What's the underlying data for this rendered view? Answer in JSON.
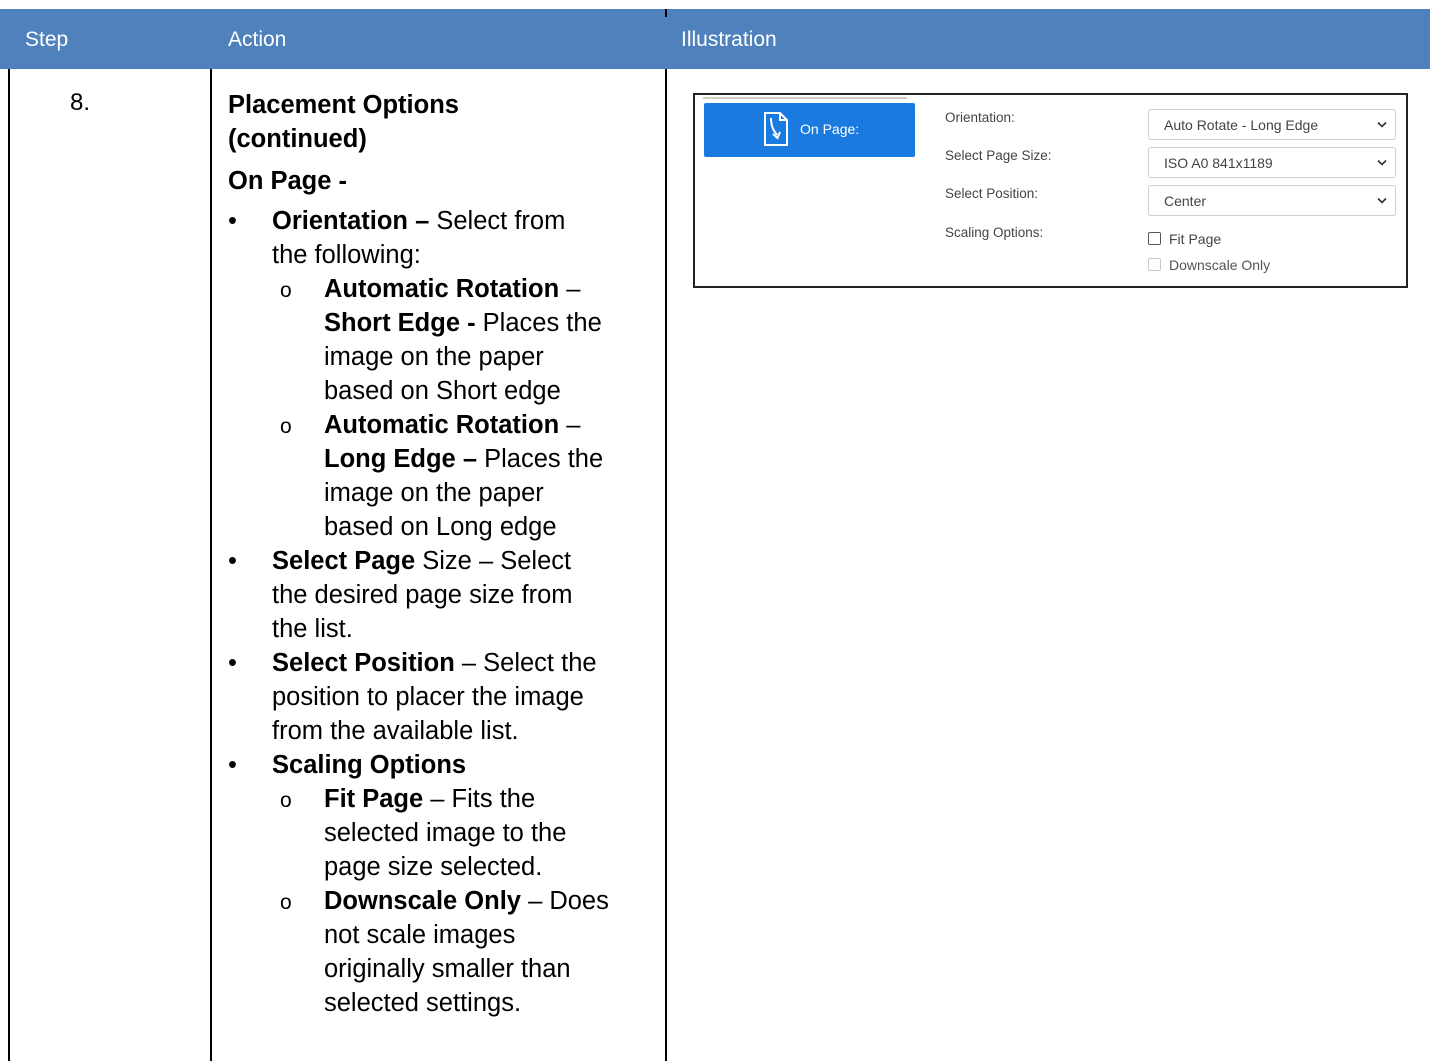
{
  "table": {
    "headers": [
      "Step",
      "Action",
      "Illustration"
    ],
    "step": "8.",
    "action": {
      "title_line1": "Placement Options",
      "title_line2": "(continued)",
      "subtitle": "On Page -",
      "orientation": {
        "term": "Orientation –",
        "text_line1": " Select from",
        "text_line2": "the following:",
        "short": {
          "term_line1": "Automatic Rotation",
          "dash": " –",
          "term_line2": "Short Edge -",
          "text_line2": " Places the",
          "text_line3": "image on the paper",
          "text_line4": "based on Short edge"
        },
        "long": {
          "term_line1": "Automatic Rotation",
          "dash": " –",
          "term_line2": "Long Edge –",
          "text_line2": " Places the",
          "text_line3": "image on the paper",
          "text_line4": "based on Long edge"
        }
      },
      "page_size": {
        "term": "Select Page",
        "text_line1": " Size – Select",
        "text_line2": "the desired page size from",
        "text_line3": "the list."
      },
      "position": {
        "term": "Select Position",
        "text_line1": " – Select the",
        "text_line2": "position to placer the image",
        "text_line3": "from the available list."
      },
      "scaling": {
        "term": "Scaling Options",
        "fit": {
          "term": "Fit Page",
          "text_line1": " – Fits the",
          "text_line2": "selected image to the",
          "text_line3": "page size selected."
        },
        "downscale": {
          "term": "Downscale Only",
          "text_line1": " – Does",
          "text_line2": "not scale images",
          "text_line3": "originally smaller than",
          "text_line4": "selected settings."
        }
      }
    }
  },
  "illustration": {
    "button_label": "On Page:",
    "button_icon": "document-arrow-icon",
    "accent_color": "#1a7ae0",
    "header_color": "#4f81bd",
    "fields": {
      "orientation": {
        "label": "Orientation:",
        "value": "Auto Rotate - Long Edge"
      },
      "page_size": {
        "label": "Select Page Size:",
        "value": "ISO A0 841x1189"
      },
      "position": {
        "label": "Select Position:",
        "value": "Center"
      },
      "scaling": {
        "label": "Scaling Options:"
      }
    },
    "checkboxes": {
      "fit_page": {
        "label": "Fit Page",
        "checked": false,
        "disabled": false
      },
      "downscale_only": {
        "label": "Downscale Only",
        "checked": false,
        "disabled": true
      }
    }
  }
}
